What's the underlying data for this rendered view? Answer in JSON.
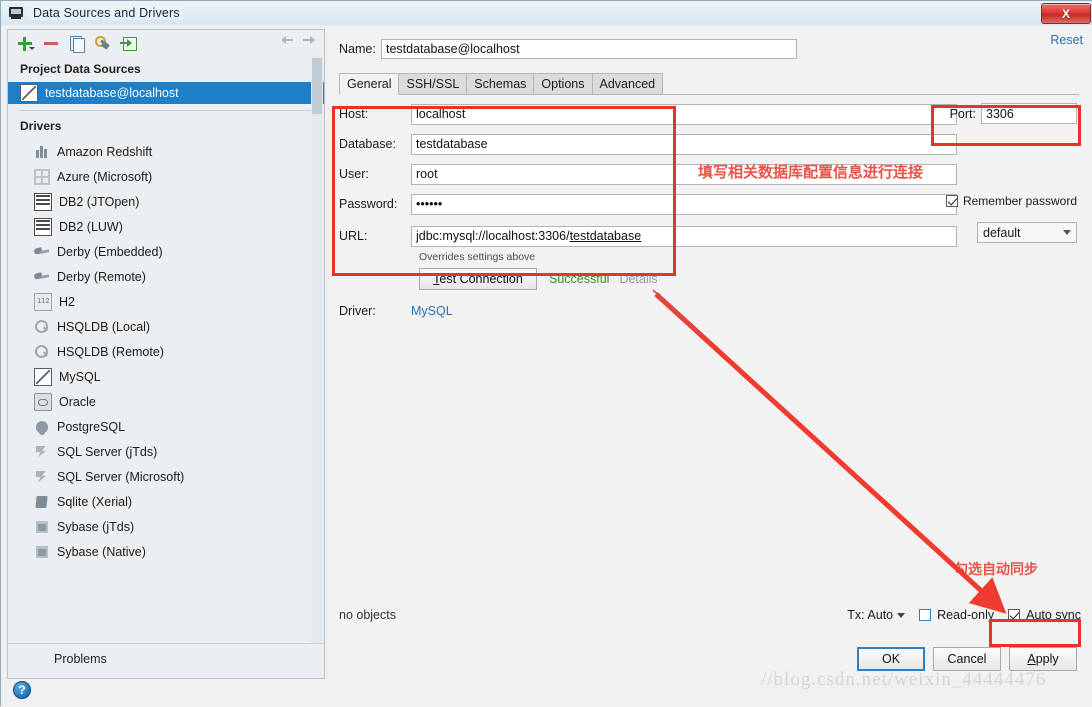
{
  "window": {
    "title": "Data Sources and Drivers",
    "close_label": "X",
    "app_icon": "database-window-icon"
  },
  "left_panel": {
    "toolbar": [
      {
        "name": "add-data-source-button",
        "icon": "plus-icon"
      },
      {
        "name": "remove-data-source-button",
        "icon": "minus-icon"
      },
      {
        "name": "copy-data-source-button",
        "icon": "copy-icon"
      },
      {
        "name": "driver-properties-button",
        "icon": "wrench-icon"
      },
      {
        "name": "import-data-source-button",
        "icon": "import-icon"
      },
      {
        "name": "navigate-back-button",
        "icon": "arrow-left-icon"
      },
      {
        "name": "navigate-forward-button",
        "icon": "arrow-right-icon"
      }
    ],
    "project_group": "Project Data Sources",
    "data_sources": [
      {
        "label": "testdatabase@localhost",
        "icon": "mysql-icon",
        "selected": true
      }
    ],
    "drivers_group": "Drivers",
    "drivers": [
      {
        "label": "Amazon Redshift",
        "icon": "redshift-icon"
      },
      {
        "label": "Azure (Microsoft)",
        "icon": "azure-icon"
      },
      {
        "label": "DB2 (JTOpen)",
        "icon": "db2-icon"
      },
      {
        "label": "DB2 (LUW)",
        "icon": "db2-icon"
      },
      {
        "label": "Derby (Embedded)",
        "icon": "derby-icon"
      },
      {
        "label": "Derby (Remote)",
        "icon": "derby-icon"
      },
      {
        "label": "H2",
        "icon": "h2-icon"
      },
      {
        "label": "HSQLDB (Local)",
        "icon": "hsqldb-icon"
      },
      {
        "label": "HSQLDB (Remote)",
        "icon": "hsqldb-icon"
      },
      {
        "label": "MySQL",
        "icon": "mysql-icon"
      },
      {
        "label": "Oracle",
        "icon": "oracle-icon"
      },
      {
        "label": "PostgreSQL",
        "icon": "postgresql-icon"
      },
      {
        "label": "SQL Server (jTds)",
        "icon": "sqlserver-icon"
      },
      {
        "label": "SQL Server (Microsoft)",
        "icon": "sqlserver-icon"
      },
      {
        "label": "Sqlite (Xerial)",
        "icon": "sqlite-icon"
      },
      {
        "label": "Sybase (jTds)",
        "icon": "sybase-icon"
      },
      {
        "label": "Sybase (Native)",
        "icon": "sybase-icon"
      }
    ],
    "problems_label": "Problems"
  },
  "main": {
    "name_label": "Name:",
    "name_value": "testdatabase@localhost",
    "reset_label": "Reset",
    "tabs": [
      {
        "label": "General",
        "active": true
      },
      {
        "label": "SSH/SSL",
        "active": false
      },
      {
        "label": "Schemas",
        "active": false
      },
      {
        "label": "Options",
        "active": false
      },
      {
        "label": "Advanced",
        "active": false
      }
    ],
    "fields": {
      "host_label": "Host:",
      "host_value": "localhost",
      "port_label": "Port:",
      "port_value": "3306",
      "database_label": "Database:",
      "database_value": "testdatabase",
      "user_label": "User:",
      "user_value": "root",
      "password_label": "Password:",
      "password_value": "••••••",
      "remember_password_label": "Remember password",
      "remember_password_checked": true,
      "url_label": "URL:",
      "url_prefix": "jdbc:mysql://localhost:3306/",
      "url_db": "testdatabase",
      "url_dropdown_value": "default",
      "overrides_note": "Overrides settings above"
    },
    "test_connection_label": "Test Connection",
    "test_connection_mnemonic": "T",
    "test_status": "Successful",
    "details_label": "Details",
    "driver_label": "Driver:",
    "driver_value": "MySQL"
  },
  "status_bar": {
    "objects_label": "no objects",
    "tx_label": "Tx: Auto",
    "read_only_label": "Read-only",
    "read_only_checked": false,
    "auto_sync_label": "Auto sync",
    "auto_sync_mnemonic": "s",
    "auto_sync_checked": true
  },
  "dialog_buttons": {
    "ok": "OK",
    "cancel": "Cancel",
    "apply": "Apply",
    "help": "?"
  },
  "annotations": {
    "note_fields": "填写相关数据库配置信息进行连接",
    "note_autosync": "勾选自动同步",
    "box_color": "#e8332a",
    "text_color": "#e8544a"
  },
  "watermark": "//blog.csdn.net/weixin_44444476"
}
